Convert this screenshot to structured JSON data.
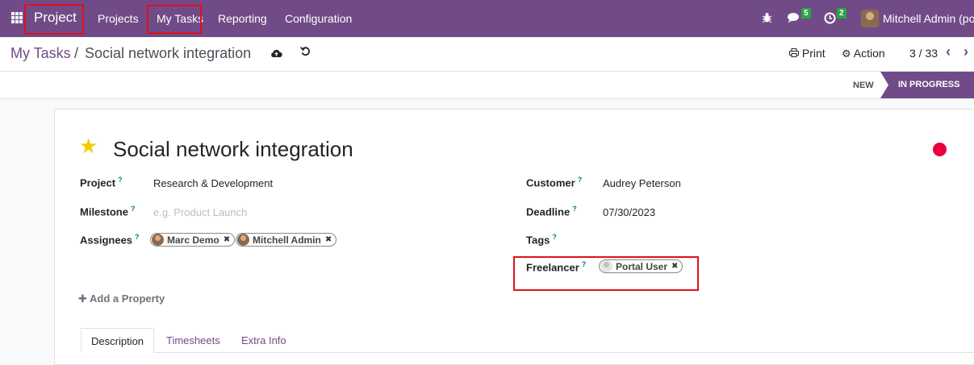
{
  "topbar": {
    "app_name": "Project",
    "nav": [
      "Projects",
      "My Tasks",
      "Reporting",
      "Configuration"
    ],
    "icons": {
      "apps": "apps-grid-icon",
      "debug": "bug-icon",
      "messages": "chat-icon",
      "activities": "clock-icon"
    },
    "messages_count": "5",
    "activities_count": "2",
    "user_name": "Mitchell Admin (por"
  },
  "breadcrumb": {
    "parent": "My Tasks",
    "separator": "/",
    "current": "Social network integration"
  },
  "toolbar": {
    "print_label": "Print",
    "action_label": "Action",
    "pager": "3 / 33"
  },
  "status": {
    "stages": [
      "NEW",
      "IN PROGRESS"
    ],
    "active_stage": "IN PROGRESS"
  },
  "task": {
    "title": "Social network integration",
    "starred": true,
    "priority_color": "#e8003c"
  },
  "fields": {
    "project_label": "Project",
    "project_value": "Research & Development",
    "milestone_label": "Milestone",
    "milestone_placeholder": "e.g. Product Launch",
    "assignees_label": "Assignees",
    "assignees": [
      "Marc Demo",
      "Mitchell Admin"
    ],
    "customer_label": "Customer",
    "customer_value": "Audrey Peterson",
    "deadline_label": "Deadline",
    "deadline_value": "07/30/2023",
    "tags_label": "Tags",
    "freelancer_label": "Freelancer",
    "freelancer_value": "Portal User",
    "help_mark": "?"
  },
  "add_property_label": "Add a Property",
  "tabs": [
    "Description",
    "Timesheets",
    "Extra Info"
  ],
  "colors": {
    "brand": "#714b87",
    "highlight": "#e0111b",
    "star": "#f3cc00"
  }
}
